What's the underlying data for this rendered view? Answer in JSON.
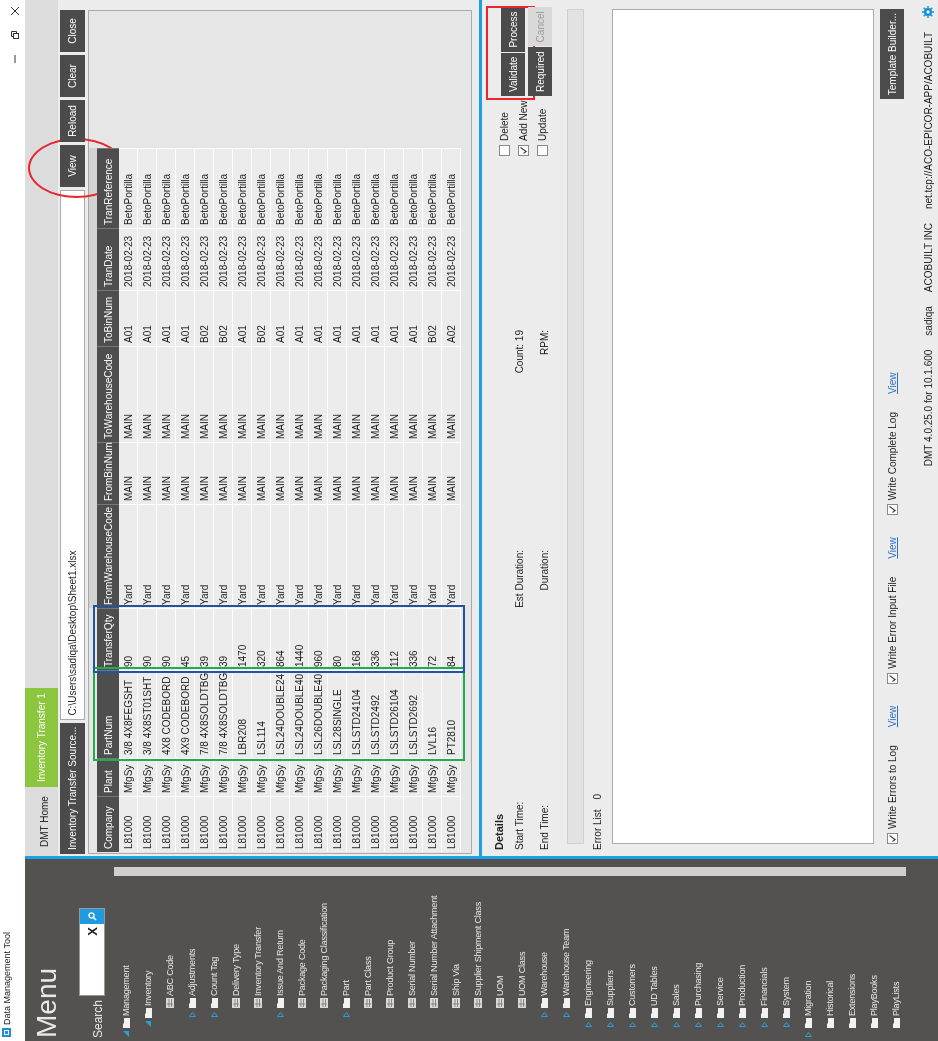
{
  "window": {
    "title": "Data Management Tool"
  },
  "menu": {
    "title": "Menu",
    "search": {
      "label": "Search",
      "clear": "X"
    }
  },
  "tree": [
    {
      "label": "Management",
      "kind": "folder",
      "expanded": true,
      "children": [
        {
          "label": "Inventory",
          "kind": "folder",
          "expanded": true,
          "children": [
            {
              "label": "ABC Code",
              "kind": "table"
            },
            {
              "label": "Adjustments",
              "kind": "folder",
              "expanded": false
            },
            {
              "label": "Count Tag",
              "kind": "folder",
              "expanded": false
            },
            {
              "label": "Delivery Type",
              "kind": "table"
            },
            {
              "label": "Inventory Transfer",
              "kind": "table"
            },
            {
              "label": "Issue And Return",
              "kind": "folder",
              "expanded": false
            },
            {
              "label": "Package Code",
              "kind": "table"
            },
            {
              "label": "Packaging Classification",
              "kind": "table"
            },
            {
              "label": "Part",
              "kind": "folder",
              "expanded": false
            },
            {
              "label": "Part Class",
              "kind": "table"
            },
            {
              "label": "Product Group",
              "kind": "table"
            },
            {
              "label": "Serial Number",
              "kind": "table"
            },
            {
              "label": "Serial Number Attachment",
              "kind": "table"
            },
            {
              "label": "Ship Via",
              "kind": "table"
            },
            {
              "label": "Supplier Shipment Class",
              "kind": "table"
            },
            {
              "label": "UOM",
              "kind": "table"
            },
            {
              "label": "UOM Class",
              "kind": "table"
            },
            {
              "label": "Warehouse",
              "kind": "folder",
              "expanded": false
            },
            {
              "label": "Warehouse Team",
              "kind": "folder",
              "expanded": false
            }
          ]
        },
        {
          "label": "Engineering",
          "kind": "folder",
          "expanded": false
        },
        {
          "label": "Suppliers",
          "kind": "folder",
          "expanded": false
        },
        {
          "label": "Customers",
          "kind": "folder",
          "expanded": false
        },
        {
          "label": "UD Tables",
          "kind": "folder",
          "expanded": false
        },
        {
          "label": "Sales",
          "kind": "folder",
          "expanded": false
        },
        {
          "label": "Purchasing",
          "kind": "folder",
          "expanded": false
        },
        {
          "label": "Service",
          "kind": "folder",
          "expanded": false
        },
        {
          "label": "Production",
          "kind": "folder",
          "expanded": false
        },
        {
          "label": "Financials",
          "kind": "folder",
          "expanded": false
        },
        {
          "label": "System",
          "kind": "folder",
          "expanded": false
        }
      ]
    },
    {
      "label": "Migration",
      "kind": "folder",
      "expanded": false
    },
    {
      "label": "Historical",
      "kind": "folder"
    },
    {
      "label": "Extensions",
      "kind": "folder"
    },
    {
      "label": "PlayBooks",
      "kind": "folder"
    },
    {
      "label": "PlayLists",
      "kind": "folder"
    }
  ],
  "tabs": [
    {
      "label": "DMT Home",
      "selected": false
    },
    {
      "label": "Inventory Transfer 1",
      "selected": true
    }
  ],
  "source": {
    "button": "Inventory Transfer Source...",
    "path": "C:\\Users\\sadiqa\\Desktop\\Sheet1.xlsx"
  },
  "toolbar": [
    {
      "label": "View",
      "highlight": {
        "kind": "ellipse",
        "color": "#e8262b"
      }
    },
    {
      "label": "Reload"
    },
    {
      "label": "Clear"
    },
    {
      "label": "Close"
    }
  ],
  "table": {
    "columns": [
      {
        "label": "Company",
        "cells": [
          "L81000",
          "L81000",
          "L81000",
          "L81000",
          "L81000",
          "L81000",
          "L81000",
          "L81000",
          "L81000",
          "L81000",
          "L81000",
          "L81000",
          "L81000",
          "L81000",
          "L81000",
          "L81000",
          "L81000",
          "L81000"
        ]
      },
      {
        "label": "Plant",
        "cells": [
          "MfgSy",
          "MfgSy",
          "MfgSy",
          "MfgSy",
          "MfgSy",
          "MfgSy",
          "MfgSy",
          "MfgSy",
          "MfgSy",
          "MfgSy",
          "MfgSy",
          "MfgSy",
          "MfgSy",
          "MfgSy",
          "MfgSy",
          "MfgSy",
          "MfgSy",
          "MfgSy"
        ]
      },
      {
        "label": "PartNum",
        "highlight": {
          "kind": "rect",
          "color": "#1fae4b"
        },
        "cells": [
          "3/8 4X8FEGSHT",
          "3/8 4X8ST01SHT",
          "4X8 CODEBORD",
          "4X9 CODEBORD",
          "7/8 4X8SOLDTBG",
          "7/8 4X8SOLDTBG",
          "LBR208",
          "LSL114",
          "LSL24DOUBLE24",
          "LSL24DOUBLE40",
          "LSL26DOUBLE40",
          "LSL28SINGLE",
          "LSLSTD24104",
          "LSLSTD2492",
          "LSLSTD26104",
          "LSLSTD2692",
          "LVL16",
          "PT2810"
        ]
      },
      {
        "label": "TransferQty",
        "highlight": {
          "kind": "rect",
          "color": "#2152a3"
        },
        "cells": [
          "90",
          "90",
          "90",
          "45",
          "39",
          "39",
          "1470",
          "320",
          "864",
          "1440",
          "960",
          "80",
          "168",
          "336",
          "112",
          "336",
          "72",
          "84"
        ]
      },
      {
        "label": "FromWarehouseCode",
        "cells": [
          "Yard",
          "Yard",
          "Yard",
          "Yard",
          "Yard",
          "Yard",
          "Yard",
          "Yard",
          "Yard",
          "Yard",
          "Yard",
          "Yard",
          "Yard",
          "Yard",
          "Yard",
          "Yard",
          "Yard",
          "Yard"
        ]
      },
      {
        "label": "FromBinNum",
        "cells": [
          "MAIN",
          "MAIN",
          "MAIN",
          "MAIN",
          "MAIN",
          "MAIN",
          "MAIN",
          "MAIN",
          "MAIN",
          "MAIN",
          "MAIN",
          "MAIN",
          "MAIN",
          "MAIN",
          "MAIN",
          "MAIN",
          "MAIN",
          "MAIN"
        ]
      },
      {
        "label": "ToWarehouseCode",
        "cells": [
          "MAIN",
          "MAIN",
          "MAIN",
          "MAIN",
          "MAIN",
          "MAIN",
          "MAIN",
          "MAIN",
          "MAIN",
          "MAIN",
          "MAIN",
          "MAIN",
          "MAIN",
          "MAIN",
          "MAIN",
          "MAIN",
          "MAIN",
          "MAIN"
        ]
      },
      {
        "label": "ToBinNum",
        "cells": [
          "A01",
          "A01",
          "A01",
          "A01",
          "B02",
          "B02",
          "A01",
          "B02",
          "A01",
          "A01",
          "A01",
          "A01",
          "A01",
          "A01",
          "A01",
          "A01",
          "B02",
          "A02"
        ]
      },
      {
        "label": "TranDate",
        "cells": [
          "2018-02-23",
          "2018-02-23",
          "2018-02-23",
          "2018-02-23",
          "2018-02-23",
          "2018-02-23",
          "2018-02-23",
          "2018-02-23",
          "2018-02-23",
          "2018-02-23",
          "2018-02-23",
          "2018-02-23",
          "2018-02-23",
          "2018-02-23",
          "2018-02-23",
          "2018-02-23",
          "2018-02-23",
          "2018-02-23"
        ]
      },
      {
        "label": "TranReference",
        "cells": [
          "BetoPortilla",
          "BetoPortilla",
          "BetoPortilla",
          "BetoPortilla",
          "BetoPortilla",
          "BetoPortilla",
          "BetoPortilla",
          "BetoPortilla",
          "BetoPortilla",
          "BetoPortilla",
          "BetoPortilla",
          "BetoPortilla",
          "BetoPortilla",
          "BetoPortilla",
          "BetoPortilla",
          "BetoPortilla",
          "BetoPortilla",
          "BetoPortilla"
        ]
      }
    ]
  },
  "details": {
    "title": "Details",
    "fields": [
      {
        "label": "Start Time:"
      },
      {
        "label": "Est Duration:"
      },
      {
        "label": "Count:",
        "value": "19"
      },
      {
        "label": "End Time:"
      },
      {
        "label": "Duration:"
      },
      {
        "label": "RPM:"
      }
    ]
  },
  "modes": [
    {
      "label": "Delete",
      "checked": false
    },
    {
      "label": "Add New",
      "checked": true
    },
    {
      "label": "Update",
      "checked": false
    }
  ],
  "actions": [
    {
      "highlight": {
        "kind": "rect",
        "color": "#e8262b"
      },
      "buttons": [
        {
          "label": "Validate",
          "disabled": false
        },
        {
          "label": "Process",
          "disabled": false
        }
      ]
    },
    {
      "buttons": [
        {
          "label": "Required",
          "disabled": false
        },
        {
          "label": "Cancel",
          "disabled": true
        }
      ]
    }
  ],
  "progress": {
    "level": 0
  },
  "error_list": {
    "label": "Error List",
    "count": "0"
  },
  "log_options": [
    {
      "label": "Write Errors to Log",
      "checked": true,
      "link": "View"
    },
    {
      "label": "Write Error Input File",
      "checked": true,
      "link": "View"
    },
    {
      "label": "Write Complete Log",
      "checked": true,
      "link": "View"
    }
  ],
  "template_button": "Template Builder...",
  "status_bar": [
    "DMT 4.0.25.0 for 10.1.600",
    "sadiqa",
    "ACOBUILT INC",
    "net.tcp://ACO-EPICOR-APP/ACOBUILT"
  ]
}
